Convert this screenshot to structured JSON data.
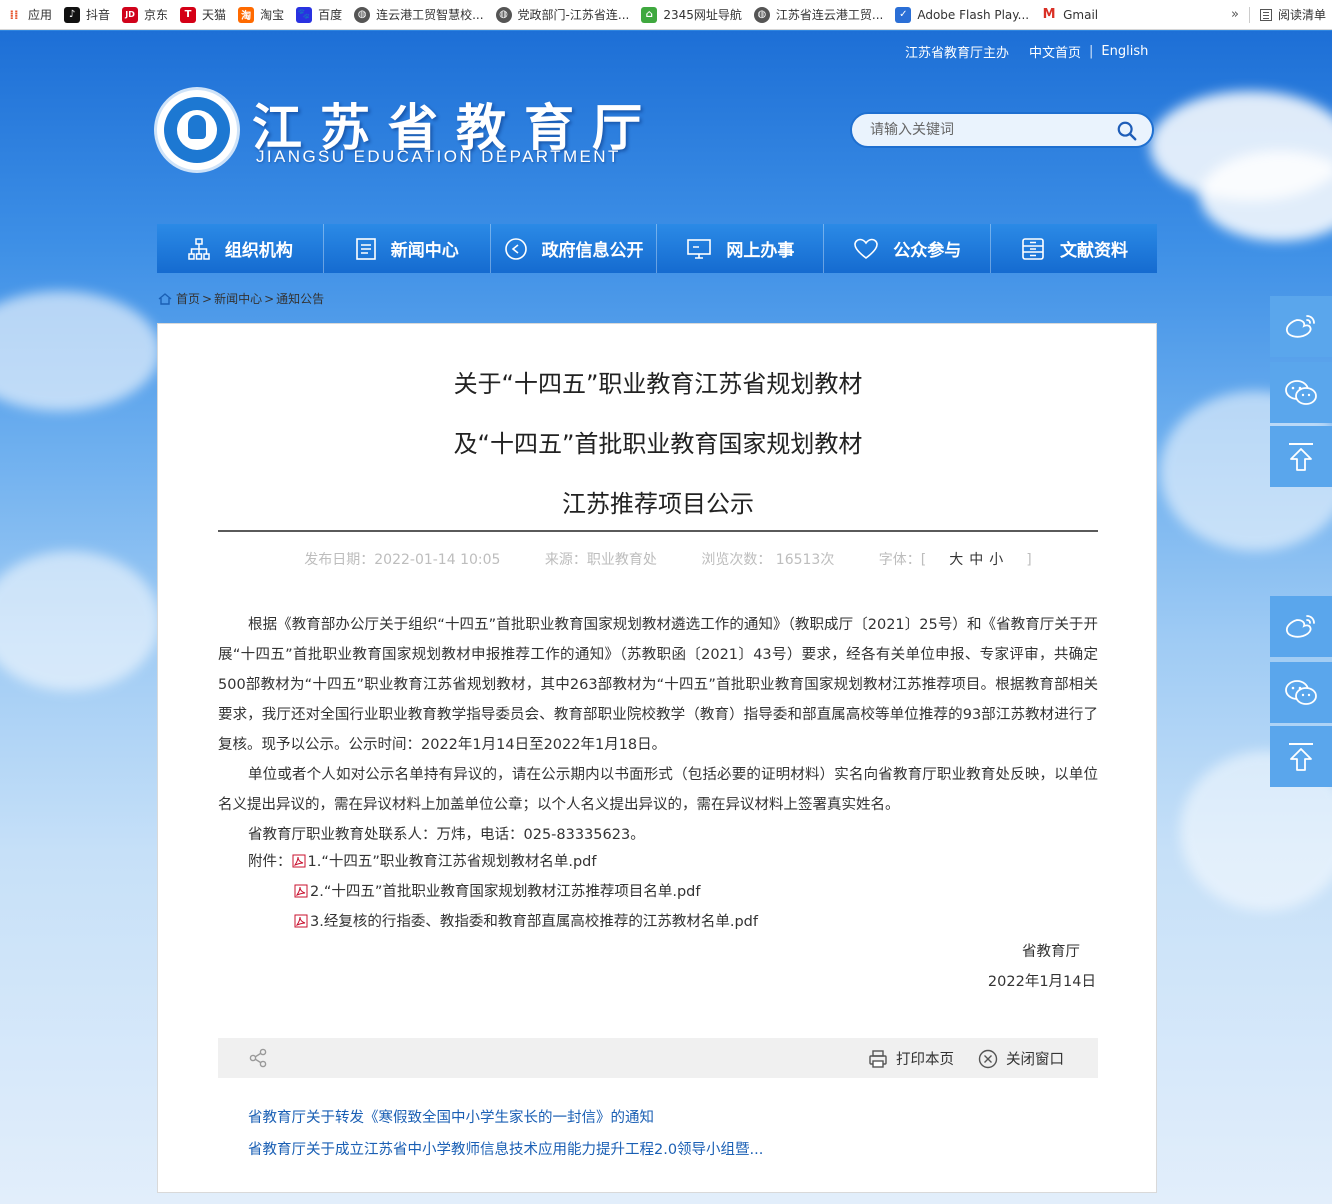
{
  "bookmarks": [
    {
      "label": "应用",
      "icon": "apps-grid-icon",
      "color": "#e7562f"
    },
    {
      "label": "抖音",
      "icon": "douyin-icon",
      "color": "#111111"
    },
    {
      "label": "京东",
      "icon": "jd-icon",
      "color": "#d0021b"
    },
    {
      "label": "天猫",
      "icon": "tmall-icon",
      "color": "#d40016"
    },
    {
      "label": "淘宝",
      "icon": "taobao-icon",
      "color": "#ff6a00"
    },
    {
      "label": "百度",
      "icon": "baidu-icon",
      "color": "#2932e1"
    },
    {
      "label": "连云港工贸智慧校...",
      "icon": "globe-icon",
      "color": "#555555"
    },
    {
      "label": "党政部门-江苏省连...",
      "icon": "globe-icon",
      "color": "#555555"
    },
    {
      "label": "2345网址导航",
      "icon": "house-icon",
      "color": "#3fa83f"
    },
    {
      "label": "江苏省连云港工贸...",
      "icon": "globe-icon",
      "color": "#555555"
    },
    {
      "label": "Adobe Flash Play...",
      "icon": "shield-icon",
      "color": "#2b6fd6"
    },
    {
      "label": "Gmail",
      "icon": "gmail-icon",
      "color": "#d93025"
    }
  ],
  "bookmarks_more": "»",
  "reading_list": "阅读清单",
  "header": {
    "top_links": [
      "江苏省教育厅主办",
      "中文首页",
      "English"
    ],
    "title": "江苏省教育厅",
    "subtitle": "JIANGSU EDUCATION DEPARTMENT",
    "search_placeholder": "请输入关键词"
  },
  "nav": [
    {
      "label": "组织机构",
      "icon": "org-chart-icon"
    },
    {
      "label": "新闻中心",
      "icon": "news-document-icon"
    },
    {
      "label": "政府信息公开",
      "icon": "info-disclosure-icon"
    },
    {
      "label": "网上办事",
      "icon": "monitor-icon"
    },
    {
      "label": "公众参与",
      "icon": "heart-icon"
    },
    {
      "label": "文献资料",
      "icon": "archive-box-icon"
    }
  ],
  "breadcrumb": [
    "首页",
    "新闻中心",
    "通知公告"
  ],
  "article": {
    "title_lines": [
      "关于“十四五”职业教育江苏省规划教材",
      "及“十四五”首批职业教育国家规划教材",
      "江苏推荐项目公示"
    ],
    "meta": {
      "date": "发布日期：2022-01-14 10:05",
      "source": "来源：职业教育处",
      "views": "浏览次数： 16513次",
      "font_label": "字体：[",
      "font_large": "大",
      "font_medium": "中",
      "font_small": "小",
      "font_end": "]"
    },
    "paragraphs": [
      "根据《教育部办公厅关于组织“十四五”首批职业教育国家规划教材遴选工作的通知》（教职成厅〔2021〕25号）和《省教育厅关于开展“十四五”首批职业教育国家规划教材申报推荐工作的通知》（苏教职函〔2021〕43号）要求，经各有关单位申报、专家评审，共确定500部教材为“十四五”职业教育江苏省规划教材，其中263部教材为“十四五”首批职业教育国家规划教材江苏推荐项目。根据教育部相关要求，我厅还对全国行业职业教育教学指导委员会、教育部职业院校教学（教育）指导委和部直属高校等单位推荐的93部江苏教材进行了复核。现予以公示。公示时间：2022年1月14日至2022年1月18日。",
      "单位或者个人如对公示名单持有异议的，请在公示期内以书面形式（包括必要的证明材料）实名向省教育厅职业教育处反映，以单位名义提出异议的，需在异议材料上加盖单位公章；以个人名义提出异议的，需在异议材料上签署真实姓名。",
      "省教育厅职业教育处联系人：万炜，电话：025-83335623。"
    ],
    "attachments_label": "附件：",
    "attachments": [
      "1.“十四五”职业教育江苏省规划教材名单.pdf",
      "2.“十四五”首批职业教育国家规划教材江苏推荐项目名单.pdf",
      "3.经复核的行指委、教指委和教育部直属高校推荐的江苏教材名单.pdf"
    ],
    "signature": "省教育厅",
    "sign_date": "2022年1月14日"
  },
  "toolbar": {
    "print": "打印本页",
    "close": "关闭窗口"
  },
  "related": [
    "省教育厅关于转发《寒假致全国中小学生家长的一封信》的通知",
    "省教育厅关于成立江苏省中小学教师信息技术应用能力提升工程2.0领导小组暨..."
  ],
  "float_buttons": [
    "weibo-icon",
    "wechat-icon",
    "back-to-top-icon",
    "weibo-icon",
    "wechat-icon",
    "back-to-top-icon"
  ]
}
